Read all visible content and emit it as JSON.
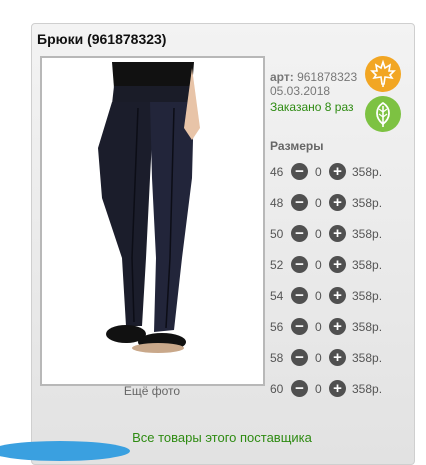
{
  "product": {
    "title": "Брюки (961878323)",
    "art_label": "арт:",
    "art_value": "961878323",
    "date": "05.03.2018",
    "ordered": "Заказано 8 раз",
    "more_photo": "Ещё фото",
    "photo_icon": "product-photo-black-trousers"
  },
  "badges": [
    {
      "icon": "maple-leaf-icon",
      "color": "#f2a623"
    },
    {
      "icon": "leaf-icon",
      "color": "#7dc242"
    }
  ],
  "sizes": {
    "label": "Размеры",
    "rows": [
      {
        "size": "46",
        "qty": "0",
        "price": "358р."
      },
      {
        "size": "48",
        "qty": "0",
        "price": "358р."
      },
      {
        "size": "50",
        "qty": "0",
        "price": "358р."
      },
      {
        "size": "52",
        "qty": "0",
        "price": "358р."
      },
      {
        "size": "54",
        "qty": "0",
        "price": "358р."
      },
      {
        "size": "56",
        "qty": "0",
        "price": "358р."
      },
      {
        "size": "58",
        "qty": "0",
        "price": "358р."
      },
      {
        "size": "60",
        "qty": "0",
        "price": "358р."
      }
    ],
    "minus_symbol": "−",
    "plus_symbol": "+"
  },
  "supplier_link": "Все товары этого поставщика",
  "colors": {
    "accent_green": "#2e8b12",
    "button_dark": "#505050"
  }
}
